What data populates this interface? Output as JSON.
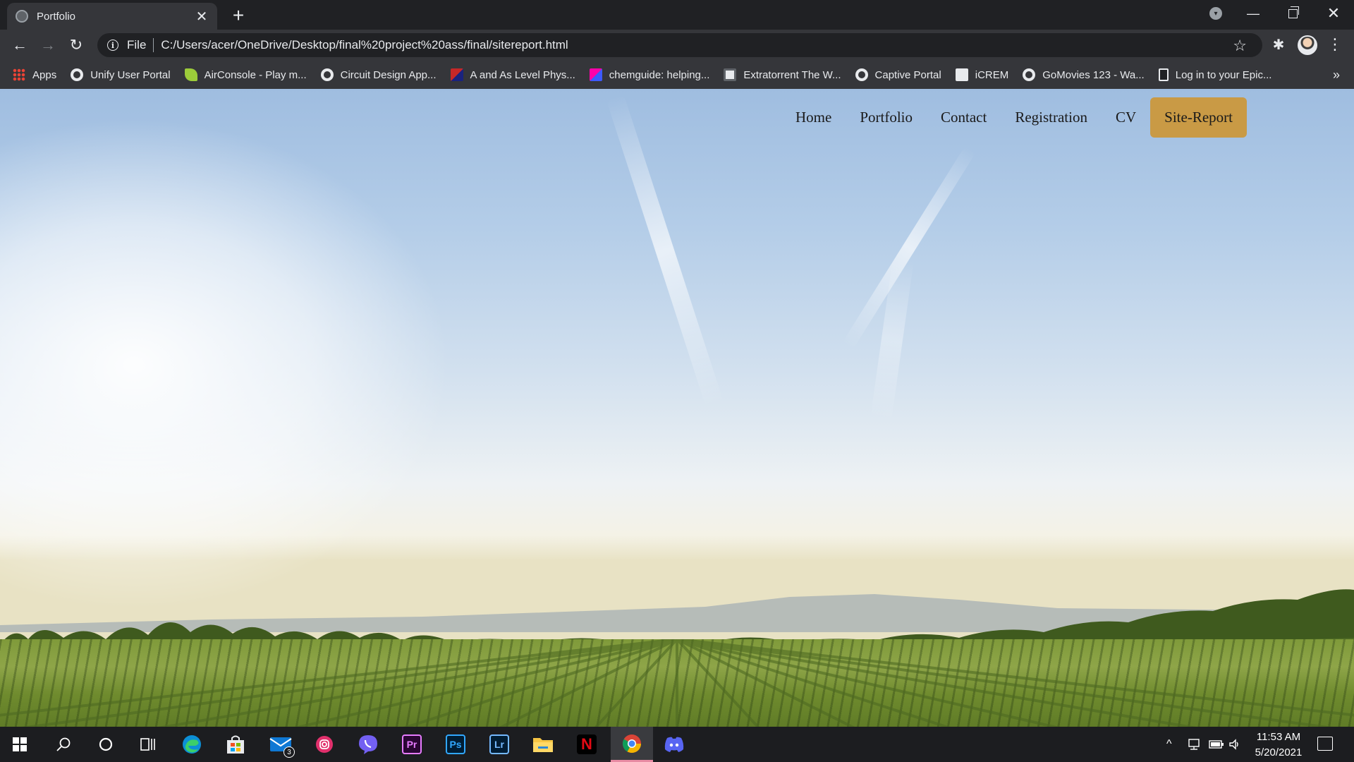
{
  "browser": {
    "tab_title": "Portfolio",
    "tab_close": "✕",
    "new_tab": "+",
    "url_scheme": "File",
    "url": "C:/Users/acer/OneDrive/Desktop/final%20project%20ass/final/sitereport.html",
    "icons": {
      "back": "←",
      "forward": "→",
      "reload": "↻",
      "info": "i",
      "star": "☆",
      "extensions": "✱",
      "menu": "⋮",
      "minimize": "—",
      "close": "✕",
      "more_bookmarks": "»",
      "tab_search": "▾"
    }
  },
  "bookmarks": [
    {
      "label": "Apps",
      "icon": "apps-grid-icon"
    },
    {
      "label": "Unify User Portal",
      "icon": "globe-icon"
    },
    {
      "label": "AirConsole - Play m...",
      "icon": "airconsole-icon"
    },
    {
      "label": "Circuit Design App...",
      "icon": "circuit-icon"
    },
    {
      "label": "A and As Level Phys...",
      "icon": "physics-icon"
    },
    {
      "label": "chemguide: helping...",
      "icon": "chemguide-icon"
    },
    {
      "label": "Extratorrent The W...",
      "icon": "extratorrent-icon"
    },
    {
      "label": "Captive Portal",
      "icon": "globe-icon"
    },
    {
      "label": "iCREM",
      "icon": "doc-icon"
    },
    {
      "label": "GoMovies 123 - Wa...",
      "icon": "globe-icon"
    },
    {
      "label": "Log in to your Epic...",
      "icon": "epic-icon"
    }
  ],
  "site_nav": {
    "items": [
      {
        "label": "Home"
      },
      {
        "label": "Portfolio"
      },
      {
        "label": "Contact"
      },
      {
        "label": "Registration"
      },
      {
        "label": "CV"
      },
      {
        "label": "Site-Report",
        "active": true
      }
    ],
    "active_color": "#c99a45"
  },
  "taskbar": {
    "apps": [
      "windows-start-icon",
      "search-icon",
      "cortana-icon",
      "task-view-icon",
      "edge-icon",
      "store-icon",
      "mail-icon",
      "instagram-icon",
      "viber-icon",
      "premiere-pro-icon",
      "photoshop-icon",
      "lightroom-icon",
      "file-explorer-icon",
      "netflix-icon",
      "chrome-icon",
      "discord-icon"
    ],
    "mail_badge": "3",
    "tiles": {
      "premiere": "Pr",
      "photoshop": "Ps",
      "lightroom": "Lr",
      "netflix": "N"
    },
    "tray_chevron": "^",
    "time": "11:53 AM",
    "date": "5/20/2021"
  }
}
